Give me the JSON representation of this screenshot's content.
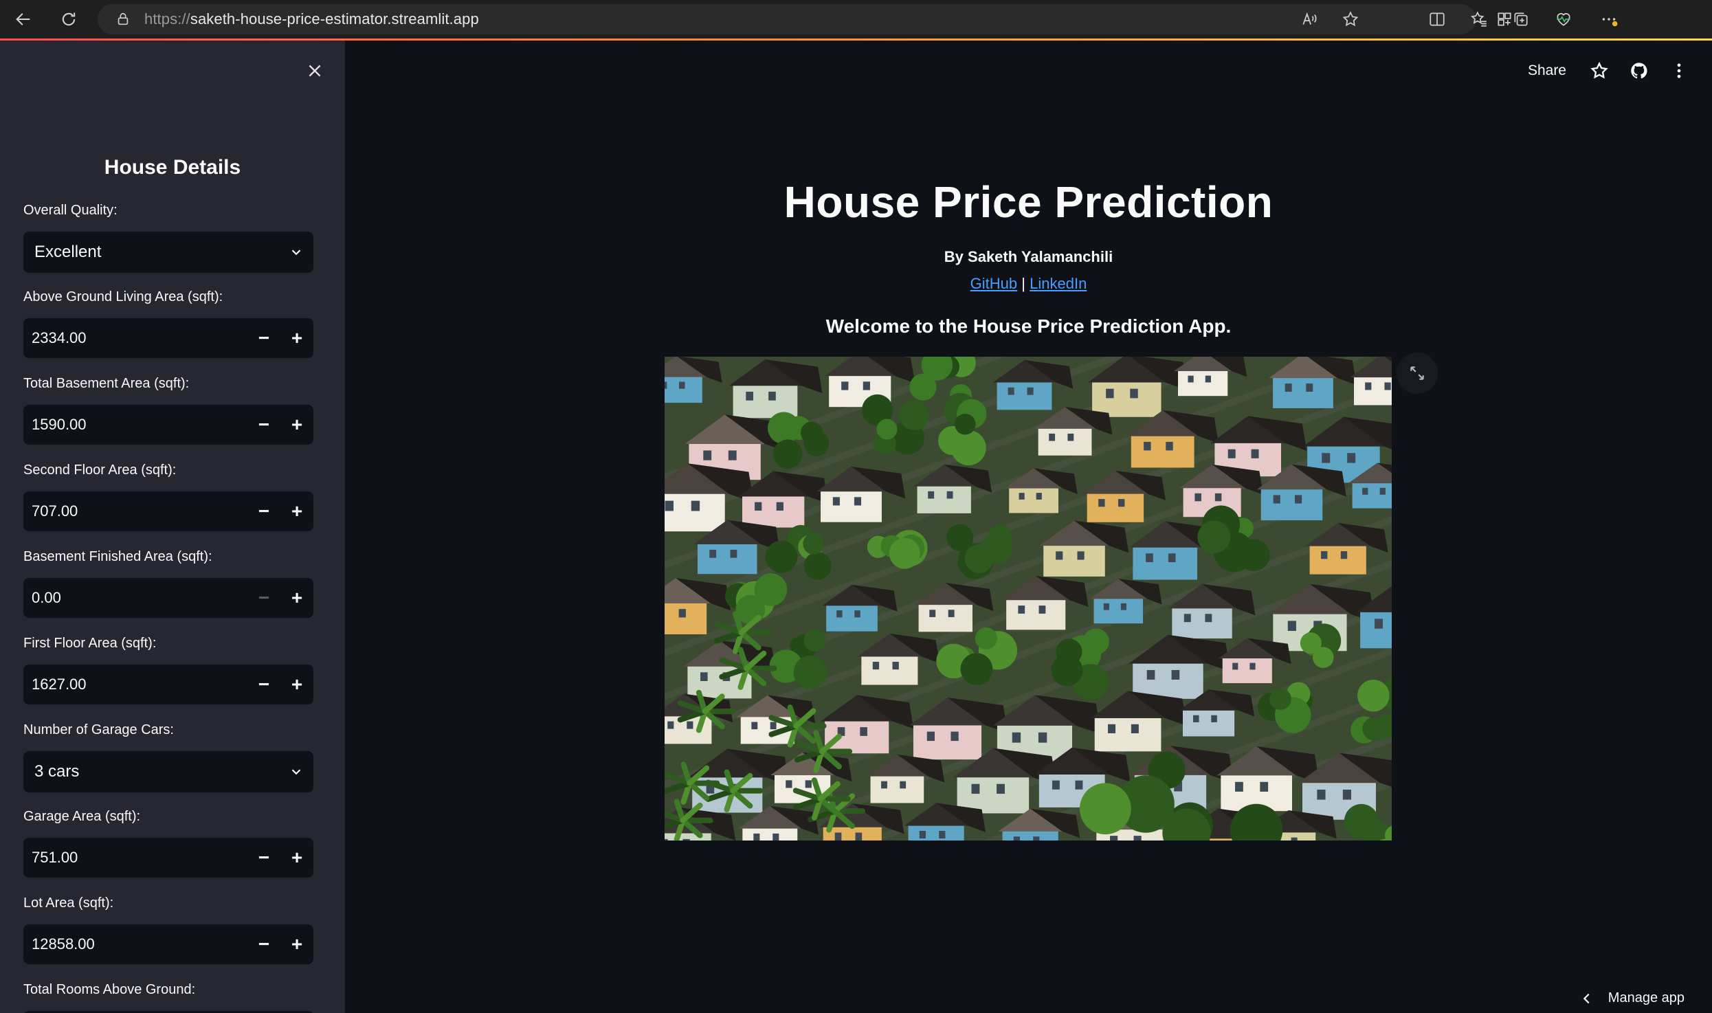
{
  "browser": {
    "url_scheme": "https://",
    "url_host": "saketh-house-price-estimator.streamlit.app"
  },
  "sidebar": {
    "title": "House Details",
    "fields": [
      {
        "label": "Overall Quality:",
        "kind": "select",
        "value": "Excellent"
      },
      {
        "label": "Above Ground Living Area (sqft):",
        "kind": "number",
        "value": "2334.00"
      },
      {
        "label": "Total Basement Area (sqft):",
        "kind": "number",
        "value": "1590.00"
      },
      {
        "label": "Second Floor Area (sqft):",
        "kind": "number",
        "value": "707.00"
      },
      {
        "label": "Basement Finished Area (sqft):",
        "kind": "number",
        "value": "0.00"
      },
      {
        "label": "First Floor Area (sqft):",
        "kind": "number",
        "value": "1627.00"
      },
      {
        "label": "Number of Garage Cars:",
        "kind": "select",
        "value": "3 cars"
      },
      {
        "label": "Garage Area (sqft):",
        "kind": "number",
        "value": "751.00"
      },
      {
        "label": "Lot Area (sqft):",
        "kind": "number",
        "value": "12858.00"
      },
      {
        "label": "Total Rooms Above Ground:",
        "kind": "number",
        "value": ""
      }
    ]
  },
  "toolbar": {
    "share_label": "Share"
  },
  "main": {
    "title": "House Price Prediction",
    "author": "By Saketh Yalamanchili",
    "github_label": "GitHub",
    "separator": "|",
    "linkedin_label": "LinkedIn",
    "welcome": "Welcome to the House Price Prediction App."
  },
  "footer": {
    "manage_app_label": "Manage app"
  },
  "colors": {
    "app_background": "#0e1117",
    "sidebar_background": "#262730",
    "link": "#4a9eff",
    "accent": "#ff4b4b"
  }
}
